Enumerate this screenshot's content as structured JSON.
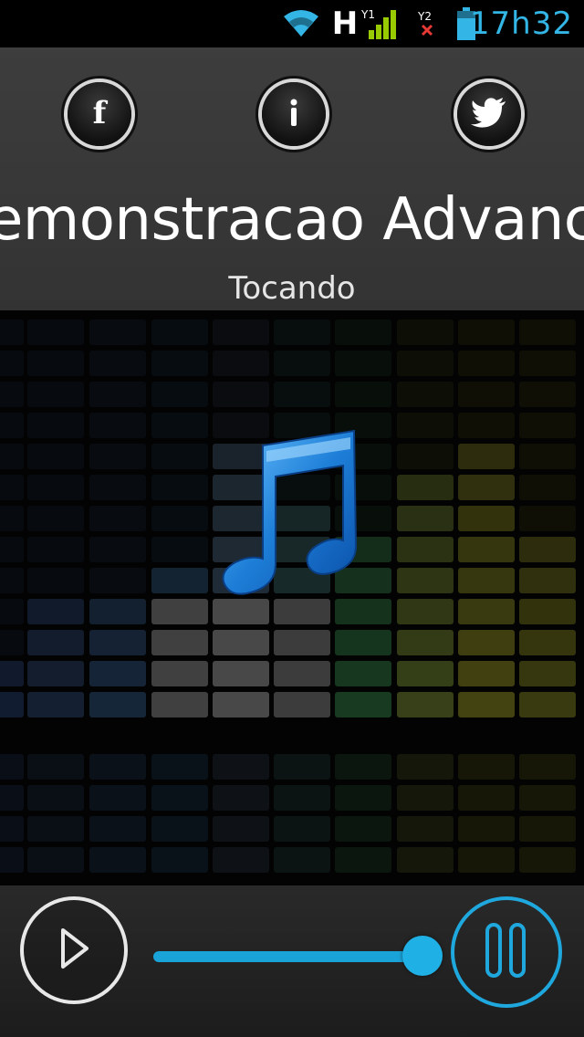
{
  "status_bar": {
    "time": "17h32",
    "network_type": "H",
    "icons": [
      "wifi-icon",
      "signal-icon",
      "sim2-no-signal-icon",
      "battery-icon"
    ],
    "accent_color": "#33b5e5"
  },
  "header": {
    "social_buttons": [
      {
        "name": "facebook",
        "icon": "facebook-icon"
      },
      {
        "name": "info",
        "icon": "info-icon"
      },
      {
        "name": "twitter",
        "icon": "twitter-icon"
      }
    ],
    "station_title": "emonstracao Advanceho",
    "playback_status": "Tocando"
  },
  "artwork": {
    "icon": "music-note-icon",
    "color": "#1e7fd8"
  },
  "player": {
    "play_icon": "play-icon",
    "pause_icon": "pause-icon",
    "progress_fraction": 0.95,
    "accent_color": "#1fb1e6"
  }
}
